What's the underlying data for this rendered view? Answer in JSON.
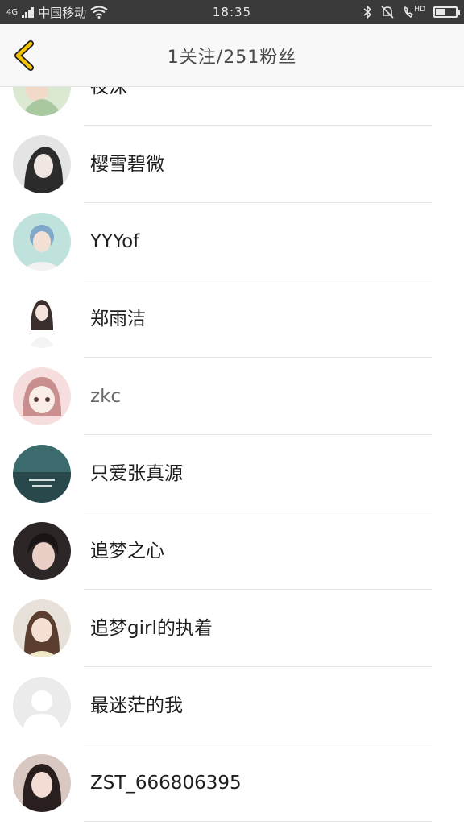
{
  "status_bar": {
    "carrier": "中国移动",
    "network": "4G",
    "time": "18:35",
    "hd_label": "HD",
    "battery_level": 0.45
  },
  "header": {
    "title": "1关注/251粉丝",
    "back_icon": "chevron-left-icon",
    "accent_color": "#f5c400"
  },
  "fans": [
    {
      "name": "夜沫"
    },
    {
      "name": "樱雪碧微"
    },
    {
      "name": "YYYof"
    },
    {
      "name": "郑雨洁"
    },
    {
      "name": "zkc"
    },
    {
      "name": "只爱张真源"
    },
    {
      "name": "追梦之心"
    },
    {
      "name": "追梦girl的执着"
    },
    {
      "name": "最迷茫的我"
    },
    {
      "name": "ZST_666806395"
    }
  ]
}
